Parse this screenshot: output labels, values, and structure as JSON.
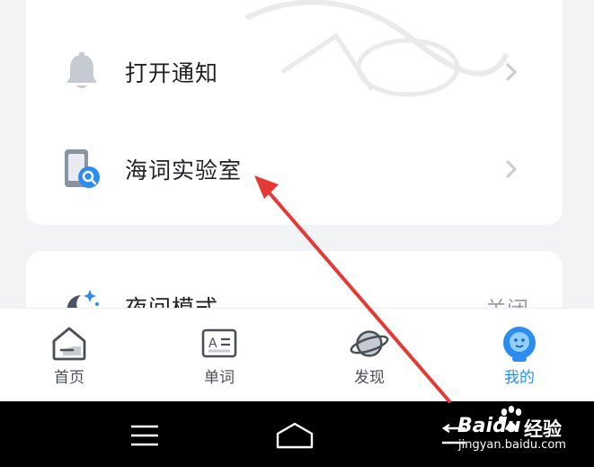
{
  "settings": {
    "notification": {
      "label": "打开通知",
      "icon": "bell-icon"
    },
    "lab": {
      "label": "海词实验室",
      "icon": "phone-search-icon"
    },
    "night_mode": {
      "label": "夜间模式",
      "value": "关闭",
      "icon": "moon-stars-icon"
    }
  },
  "tabbar": {
    "items": [
      {
        "label": "首页",
        "icon": "home-icon"
      },
      {
        "label": "单词",
        "icon": "word-card-icon"
      },
      {
        "label": "发现",
        "icon": "planet-icon"
      },
      {
        "label": "我的",
        "icon": "profile-face-icon",
        "active": true
      }
    ],
    "active_color": "#2d8cf0"
  },
  "system_nav": {
    "buttons": [
      "menu-icon",
      "home-icon",
      "back-icon"
    ]
  },
  "watermark": {
    "brand": "Baidu",
    "suffix": "经验",
    "url": "jingyan.baidu.com"
  },
  "annotation": {
    "color": "#e53935"
  }
}
